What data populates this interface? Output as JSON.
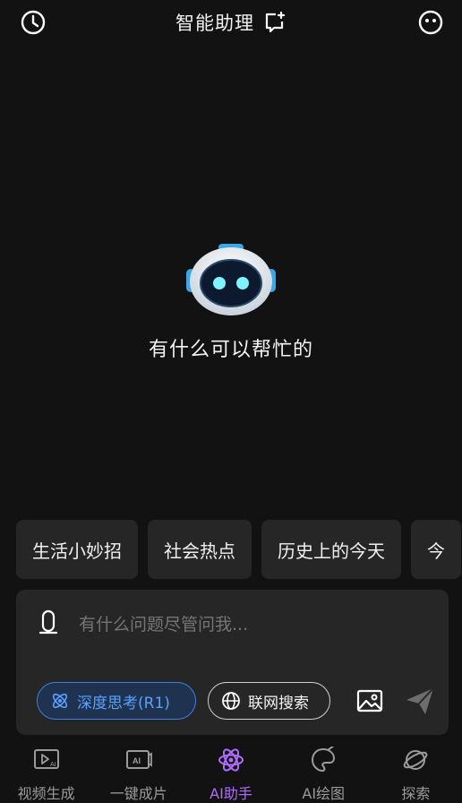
{
  "header": {
    "title": "智能助理",
    "history_icon": "clock-icon",
    "new_chat_icon": "new-chat-icon",
    "profile_icon": "face-icon"
  },
  "hero": {
    "avatar_icon": "robot-icon",
    "greeting": "有什么可以帮忙的"
  },
  "suggestions": [
    "生活小妙招",
    "社会热点",
    "历史上的今天",
    "今"
  ],
  "composer": {
    "placeholder": "有什么问题尽管问我...",
    "deep_think_label": "深度思考(R1)",
    "web_search_label": "联网搜索"
  },
  "tabs": [
    {
      "label": "视频生成",
      "icon": "video-ai-icon",
      "active": false
    },
    {
      "label": "一键成片",
      "icon": "ai-clip-icon",
      "active": false
    },
    {
      "label": "AI助手",
      "icon": "atom-icon",
      "active": true
    },
    {
      "label": "AI绘图",
      "icon": "palette-icon",
      "active": false
    },
    {
      "label": "探索",
      "icon": "planet-icon",
      "active": false
    }
  ],
  "colors": {
    "background": "#121212",
    "surface": "#262626",
    "accent_blue": "#3d7fe0",
    "accent_purple": "#b06cff"
  }
}
